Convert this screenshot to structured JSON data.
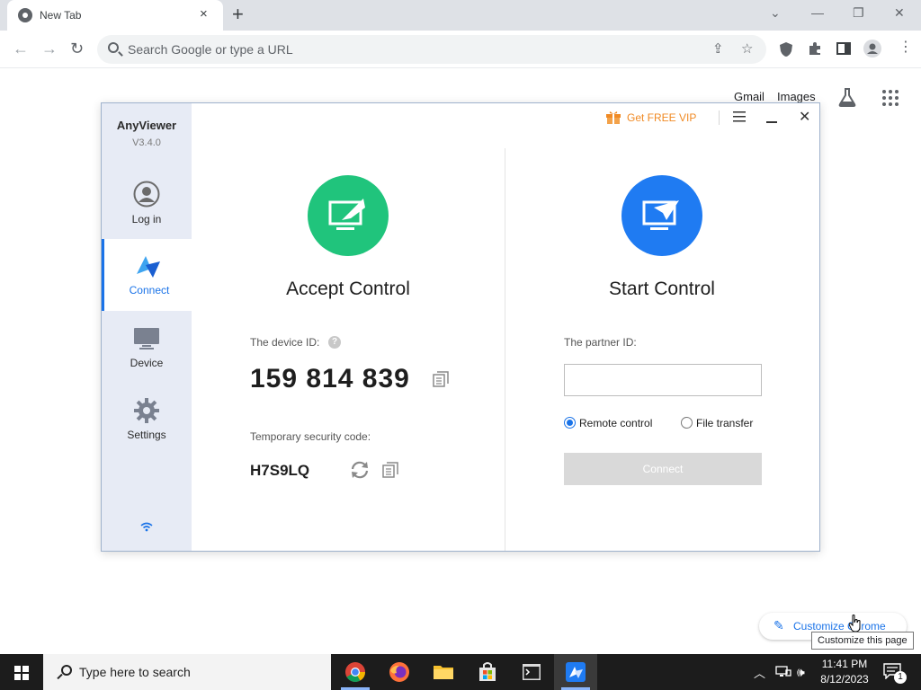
{
  "browser": {
    "tab_title": "New Tab",
    "tab_close": "×",
    "new_tab": "+",
    "omnibox_placeholder": "Search Google or type a URL",
    "win_min": "—",
    "win_restore": "❐",
    "win_close": "✕",
    "tab_search": "⌄"
  },
  "ntp": {
    "gmail": "Gmail",
    "images": "Images",
    "customize_label": "Customize Chrome",
    "tooltip": "Customize this page"
  },
  "anyviewer": {
    "app_name": "AnyViewer",
    "version": "V3.4.0",
    "nav": [
      {
        "label": "Log in",
        "icon": "user-icon"
      },
      {
        "label": "Connect",
        "icon": "connect-icon"
      },
      {
        "label": "Device",
        "icon": "monitor-icon"
      },
      {
        "label": "Settings",
        "icon": "gear-icon"
      }
    ],
    "vip_label": "Get FREE VIP",
    "close": "✕",
    "accept": {
      "title": "Accept Control",
      "device_id_label": "The device ID:",
      "help": "?",
      "device_id": "159 814 839",
      "temp_code_label": "Temporary security code:",
      "temp_code": "H7S9LQ"
    },
    "start": {
      "title": "Start Control",
      "partner_label": "The partner ID:",
      "partner_value": "",
      "option_remote": "Remote control",
      "option_file": "File transfer",
      "selected_option": "Remote control",
      "connect_label": "Connect"
    },
    "colors": {
      "accept_green": "#20c47c",
      "start_blue": "#1f7bf2",
      "vip_orange": "#f08a24",
      "accent": "#1a73e8"
    }
  },
  "taskbar": {
    "search_placeholder": "Type here to search",
    "apps": [
      "chrome-icon",
      "firefox-icon",
      "file-explorer-icon",
      "store-icon",
      "terminal-icon",
      "anyviewer-icon"
    ],
    "time": "11:41 PM",
    "date": "8/12/2023",
    "notification_count": "1"
  }
}
